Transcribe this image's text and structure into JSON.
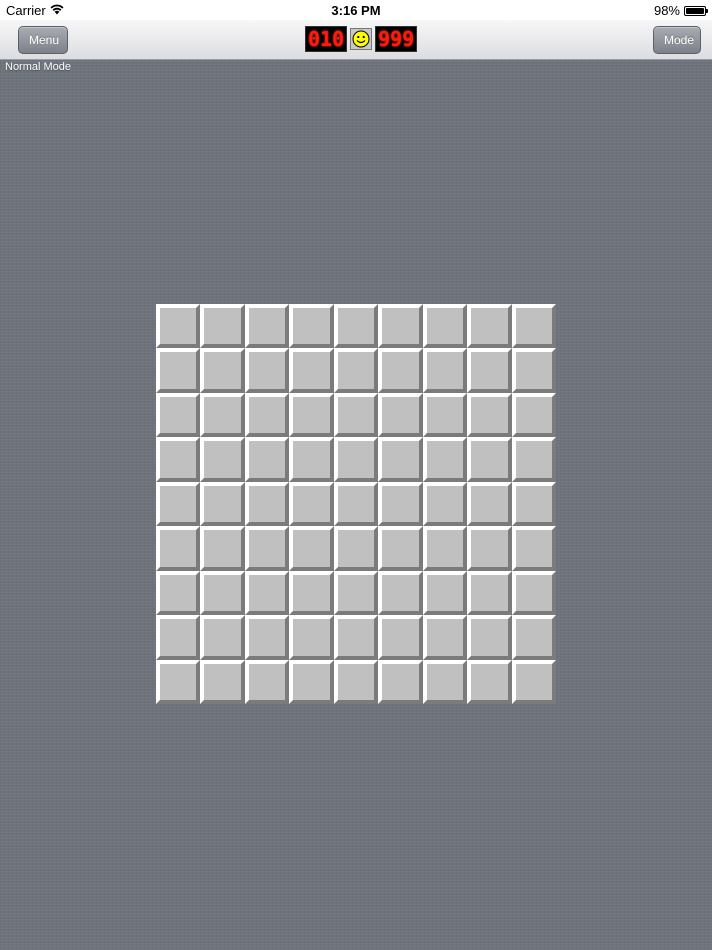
{
  "status_bar": {
    "carrier": "Carrier",
    "time": "3:16 PM",
    "battery": "98%",
    "battery_level": 0.98
  },
  "nav": {
    "menu_label": "Menu",
    "mode_label": "Mode",
    "mine_counter": "010",
    "timer": "999",
    "face_icon": "smiley-face-icon"
  },
  "mode_text": "Normal Mode",
  "board": {
    "rows": 9,
    "cols": 9,
    "state": "all-unrevealed"
  },
  "colors": {
    "counter_digits": "#ff1a0a",
    "cell_face": "#c0c0c0",
    "background": "#6f747c"
  }
}
